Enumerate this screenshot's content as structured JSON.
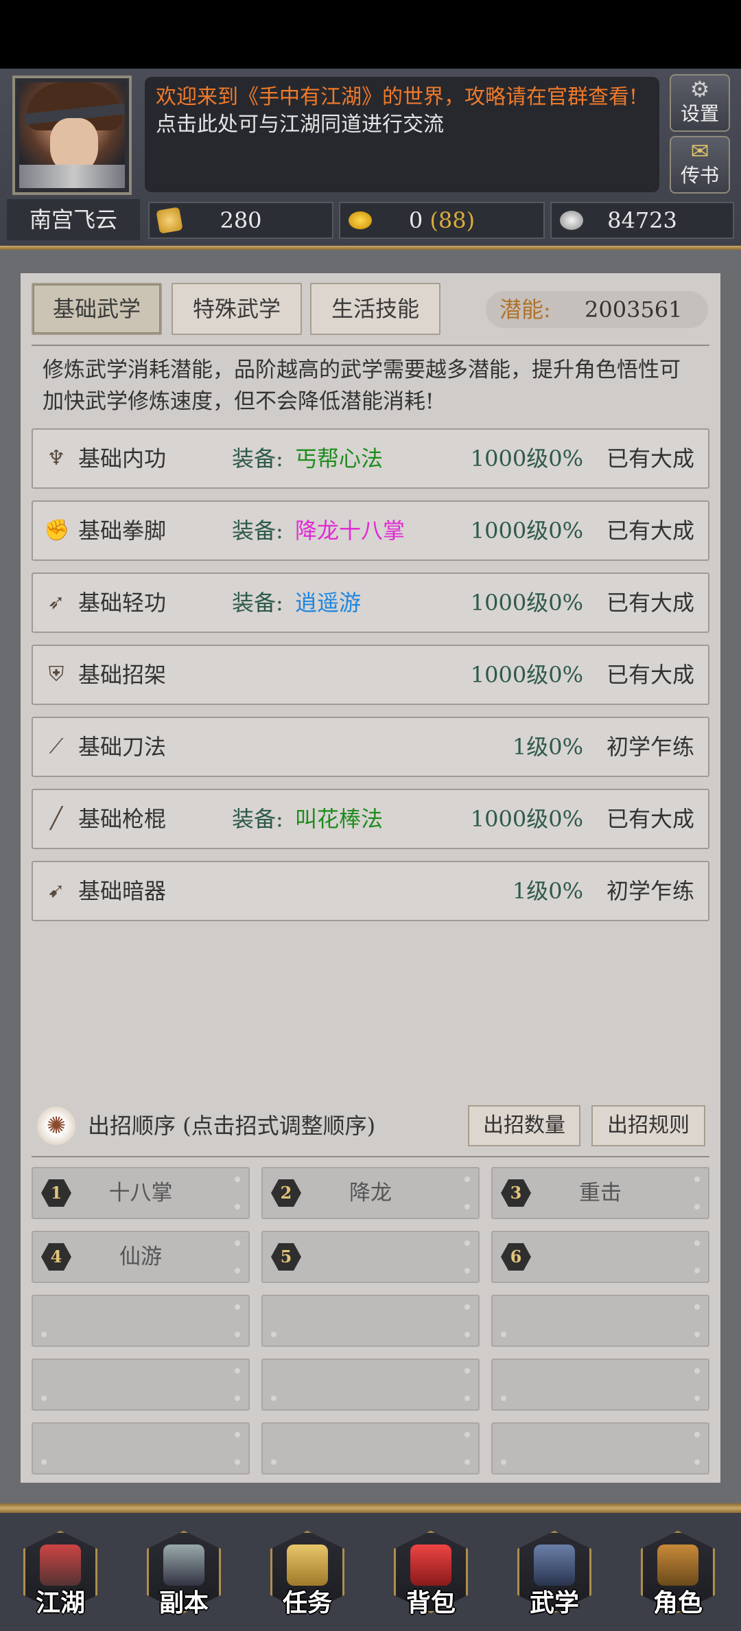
{
  "header": {
    "announcement_line1": "欢迎来到《手中有江湖》的世界，攻略请在官群查看!",
    "announcement_line2": "点击此处可与江湖同道进行交流",
    "settings_label": "设置",
    "mail_label": "传书",
    "player_name": "南宫飞云",
    "currency1": "280",
    "currency2_main": "0",
    "currency2_extra": "(88)",
    "currency3": "84723"
  },
  "tabs": {
    "basic": "基础武学",
    "special": "特殊武学",
    "life": "生活技能"
  },
  "potential": {
    "label": "潜能:",
    "value": "2003561"
  },
  "description": "修炼武学消耗潜能，品阶越高的武学需要越多潜能，提升角色悟性可加快武学修炼速度，但不会降低潜能消耗!",
  "skills": [
    {
      "icon": "inner-power-icon",
      "name": "基础内功",
      "equip_label": "装备:",
      "equip": "丐帮心法",
      "equip_color": "#1e8c1e",
      "level": "1000级0%",
      "stage": "已有大成"
    },
    {
      "icon": "fist-icon",
      "name": "基础拳脚",
      "equip_label": "装备:",
      "equip": "降龙十八掌",
      "equip_color": "#e02ad6",
      "level": "1000级0%",
      "stage": "已有大成"
    },
    {
      "icon": "boot-icon",
      "name": "基础轻功",
      "equip_label": "装备:",
      "equip": "逍遥游",
      "equip_color": "#1e86e0",
      "level": "1000级0%",
      "stage": "已有大成"
    },
    {
      "icon": "parry-icon",
      "name": "基础招架",
      "equip_label": "",
      "equip": "",
      "equip_color": "#333333",
      "level": "1000级0%",
      "stage": "已有大成"
    },
    {
      "icon": "blade-icon",
      "name": "基础刀法",
      "equip_label": "",
      "equip": "",
      "equip_color": "#333333",
      "level": "1级0%",
      "stage": "初学乍练"
    },
    {
      "icon": "staff-icon",
      "name": "基础枪棍",
      "equip_label": "装备:",
      "equip": "叫花棒法",
      "equip_color": "#1e8c1e",
      "level": "1000级0%",
      "stage": "已有大成"
    },
    {
      "icon": "dart-icon",
      "name": "基础暗器",
      "equip_label": "",
      "equip": "",
      "equip_color": "#333333",
      "level": "1级0%",
      "stage": "初学乍练"
    }
  ],
  "combo": {
    "title": "出招顺序 (点击招式调整顺序)",
    "count_btn": "出招数量",
    "rule_btn": "出招规则",
    "slots": [
      {
        "num": "1",
        "name": "十八掌"
      },
      {
        "num": "2",
        "name": "降龙"
      },
      {
        "num": "3",
        "name": "重击"
      },
      {
        "num": "4",
        "name": "仙游"
      },
      {
        "num": "5",
        "name": ""
      },
      {
        "num": "6",
        "name": ""
      },
      {
        "num": "",
        "name": ""
      },
      {
        "num": "",
        "name": ""
      },
      {
        "num": "",
        "name": ""
      },
      {
        "num": "",
        "name": ""
      },
      {
        "num": "",
        "name": ""
      },
      {
        "num": "",
        "name": ""
      },
      {
        "num": "",
        "name": ""
      },
      {
        "num": "",
        "name": ""
      },
      {
        "num": "",
        "name": ""
      }
    ]
  },
  "nav": [
    {
      "label": "江湖",
      "icon": "pagoda-icon"
    },
    {
      "label": "副本",
      "icon": "crossed-swords-icon"
    },
    {
      "label": "任务",
      "icon": "scroll-icon"
    },
    {
      "label": "背包",
      "icon": "pouch-icon"
    },
    {
      "label": "武学",
      "icon": "book-sword-icon"
    },
    {
      "label": "角色",
      "icon": "gourd-icon"
    }
  ]
}
